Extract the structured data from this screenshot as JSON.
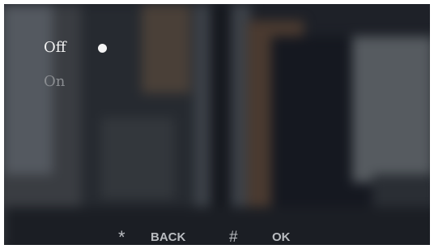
{
  "menu": {
    "options": [
      {
        "label": "Off",
        "selected": true
      },
      {
        "label": "On",
        "selected": false
      }
    ]
  },
  "footer": {
    "back_key": "*",
    "back_label": "BACK",
    "ok_key": "#",
    "ok_label": "OK"
  },
  "colors": {
    "selected_text": "#f2f2f2",
    "unselected_text": "#8a8d91",
    "footer_text": "#b9bcc0"
  }
}
